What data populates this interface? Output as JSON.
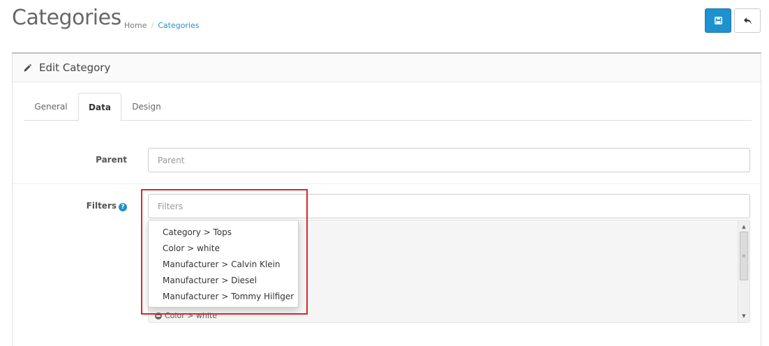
{
  "header": {
    "title": "Categories",
    "breadcrumb": [
      "Home",
      "Categories"
    ],
    "breadcrumb_separator": "/"
  },
  "toolbar": {
    "save_icon": "floppy-disk-icon",
    "back_icon": "reply-arrow-icon",
    "save_color": "#1e91cf"
  },
  "panel": {
    "heading_icon": "pencil-icon",
    "title": "Edit Category"
  },
  "tabs": [
    {
      "label": "General",
      "active": false
    },
    {
      "label": "Data",
      "active": true
    },
    {
      "label": "Design",
      "active": false
    }
  ],
  "form": {
    "parent": {
      "label": "Parent",
      "value": "",
      "placeholder": "Parent"
    },
    "filters": {
      "label": "Filters",
      "help_icon": "question-circle-icon",
      "help_text": "?",
      "value": "",
      "placeholder": "Filters",
      "selected": [
        "Color > white"
      ]
    }
  },
  "autocomplete": {
    "items": [
      "Category > Tops",
      "Color > white",
      "Manufacturer > Calvin Klein",
      "Manufacturer > Diesel",
      "Manufacturer > Tommy Hilfiger"
    ]
  },
  "annotation": {
    "highlight_color": "#d9262c"
  }
}
